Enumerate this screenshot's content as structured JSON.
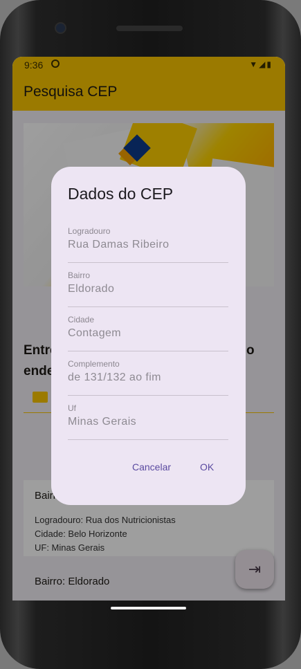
{
  "status": {
    "time": "9:36"
  },
  "appbar": {
    "title": "Pesquisa CEP"
  },
  "background": {
    "heading_line1": "Entre",
    "heading_suffix": "o",
    "heading_line2": "ende",
    "card": {
      "bairro": "Bairr",
      "logradouro": "Logradouro: Rua dos Nutricionistas",
      "cidade": "Cidade: Belo Horizonte",
      "uf": "UF: Minas Gerais"
    },
    "bairro2": "Bairro: Eldorado"
  },
  "dialog": {
    "title": "Dados do CEP",
    "fields": [
      {
        "label": "Logradouro",
        "value": "Rua Damas Ribeiro"
      },
      {
        "label": "Bairro",
        "value": "Eldorado"
      },
      {
        "label": "Cidade",
        "value": "Contagem"
      },
      {
        "label": "Complemento",
        "value": "de 131/132 ao fim"
      },
      {
        "label": "Uf",
        "value": "Minas Gerais"
      }
    ],
    "cancel_label": "Cancelar",
    "ok_label": "OK"
  },
  "colors": {
    "accent": "#fbc500",
    "dialog_bg": "#ede5f3",
    "button_text": "#5a4aa0"
  },
  "icons": {
    "fab": "logout-icon",
    "input": "mail-icon"
  }
}
